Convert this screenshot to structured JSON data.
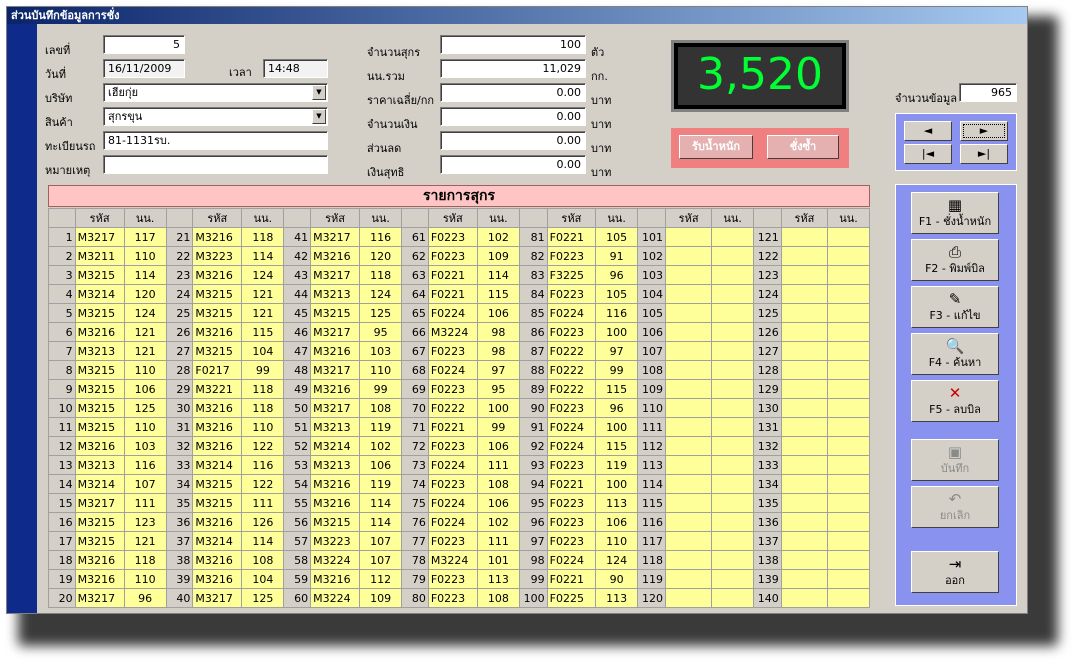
{
  "window": {
    "title": "ส่วนบันทึกข้อมูลการชั่ง"
  },
  "form": {
    "doc_no_label": "เลขที่",
    "doc_no": "5",
    "date_label": "วันที่",
    "date": "16/11/2009",
    "time_label": "เวลา",
    "time": "14:48",
    "company_label": "บริษัท",
    "company": "เฮียกุ่ย",
    "product_label": "สินค้า",
    "product": "สุกรขุน",
    "plate_label": "ทะเบียนรถ",
    "plate": "81-1131รบ.",
    "note_label": "หมายเหตุ",
    "note": "",
    "pig_count_label": "จำนวนสุกร",
    "pig_count": "100",
    "pig_count_unit": "ตัว",
    "total_weight_label": "นน.รวม",
    "total_weight": "11,029",
    "total_weight_unit": "กก.",
    "avg_price_label": "ราคาเฉลี่ย/กก",
    "avg_price": "0.00",
    "avg_price_unit": "บาท",
    "amount_label": "จำนวนเงิน",
    "amount": "0.00",
    "amount_unit": "บาท",
    "discount_label": "ส่วนลด",
    "discount": "0.00",
    "discount_unit": "บาท",
    "net_label": "เงินสุทธิ",
    "net": "0.00",
    "net_unit": "บาท"
  },
  "display": {
    "weight": "3,520",
    "color": "#00ff33"
  },
  "weigh_buttons": {
    "receive": "รับน้ำหนัก",
    "reweigh": "ชั่งซ้ำ"
  },
  "record_count": {
    "label": "จำนวนข้อมูล",
    "value": "965"
  },
  "nav": {
    "prev": "◄",
    "next": "►",
    "first": "|◄",
    "last": "►|"
  },
  "functions": [
    {
      "icon": "calculator-icon",
      "glyph": "▦",
      "label": "F1 - ชั่งน้ำหนัก",
      "enabled": true
    },
    {
      "icon": "printer-icon",
      "glyph": "⎙",
      "label": "F2 - พิมพ์บิล",
      "enabled": true
    },
    {
      "icon": "wrench-icon",
      "glyph": "✎",
      "label": "F3 - แก้ไข",
      "enabled": true
    },
    {
      "icon": "find-icon",
      "glyph": "🔍",
      "label": "F4 - ค้นหา",
      "enabled": true
    },
    {
      "icon": "delete-icon",
      "glyph": "✕",
      "label": "F5 - ลบบิล",
      "enabled": true
    },
    {
      "icon": "save-icon",
      "glyph": "▣",
      "label": "บันทึก",
      "enabled": false
    },
    {
      "icon": "undo-icon",
      "glyph": "↶",
      "label": "ยกเลิก",
      "enabled": false
    },
    {
      "icon": "exit-icon",
      "glyph": "⇥",
      "label": "ออก",
      "enabled": true
    }
  ],
  "table": {
    "title": "รายการสุกร",
    "col_code": "รหัส",
    "col_weight": "นน.",
    "columns": [
      {
        "codes": [
          "M3217",
          "M3211",
          "M3215",
          "M3214",
          "M3215",
          "M3216",
          "M3213",
          "M3215",
          "M3215",
          "M3215",
          "M3215",
          "M3216",
          "M3213",
          "M3214",
          "M3217",
          "M3215",
          "M3215",
          "M3216",
          "M3216",
          "M3217"
        ],
        "weights": [
          "117",
          "110",
          "114",
          "120",
          "124",
          "121",
          "121",
          "110",
          "106",
          "125",
          "110",
          "103",
          "116",
          "107",
          "111",
          "123",
          "121",
          "118",
          "110",
          "96"
        ]
      },
      {
        "codes": [
          "M3216",
          "M3223",
          "M3216",
          "M3215",
          "M3215",
          "M3216",
          "M3215",
          "F0217",
          "M3221",
          "M3216",
          "M3216",
          "M3216",
          "M3214",
          "M3215",
          "M3215",
          "M3216",
          "M3214",
          "M3216",
          "M3216",
          "M3217"
        ],
        "weights": [
          "118",
          "114",
          "124",
          "121",
          "121",
          "115",
          "104",
          "99",
          "118",
          "118",
          "110",
          "122",
          "116",
          "122",
          "111",
          "126",
          "114",
          "108",
          "104",
          "125"
        ]
      },
      {
        "codes": [
          "M3217",
          "M3216",
          "M3217",
          "M3213",
          "M3215",
          "M3217",
          "M3216",
          "M3217",
          "M3216",
          "M3217",
          "M3213",
          "M3214",
          "M3213",
          "M3216",
          "M3216",
          "M3215",
          "M3223",
          "M3224",
          "M3216",
          "M3224"
        ],
        "weights": [
          "116",
          "120",
          "118",
          "124",
          "125",
          "95",
          "103",
          "110",
          "99",
          "108",
          "119",
          "102",
          "106",
          "119",
          "114",
          "114",
          "107",
          "107",
          "112",
          "109"
        ]
      },
      {
        "codes": [
          "F0223",
          "F0223",
          "F0221",
          "F0221",
          "F0224",
          "M3224",
          "F0223",
          "F0224",
          "F0223",
          "F0222",
          "F0221",
          "F0223",
          "F0224",
          "F0223",
          "F0224",
          "F0224",
          "F0223",
          "M3224",
          "F0223",
          "F0223"
        ],
        "weights": [
          "102",
          "109",
          "114",
          "115",
          "106",
          "98",
          "98",
          "97",
          "95",
          "100",
          "99",
          "106",
          "111",
          "108",
          "106",
          "102",
          "111",
          "101",
          "113",
          "108"
        ]
      },
      {
        "codes": [
          "F0221",
          "F0223",
          "F3225",
          "F0223",
          "F0224",
          "F0223",
          "F0222",
          "F0222",
          "F0222",
          "F0223",
          "F0224",
          "F0224",
          "F0223",
          "F0221",
          "F0223",
          "F0223",
          "F0223",
          "F0224",
          "F0221",
          "F0225"
        ],
        "weights": [
          "105",
          "91",
          "96",
          "105",
          "116",
          "100",
          "97",
          "99",
          "115",
          "96",
          "100",
          "115",
          "119",
          "100",
          "113",
          "106",
          "110",
          "124",
          "90",
          "113"
        ]
      },
      {
        "codes": [
          "",
          "",
          "",
          "",
          "",
          "",
          "",
          "",
          "",
          "",
          "",
          "",
          "",
          "",
          "",
          "",
          "",
          "",
          "",
          ""
        ],
        "weights": [
          "",
          "",
          "",
          "",
          "",
          "",
          "",
          "",
          "",
          "",
          "",
          "",
          "",
          "",
          "",
          "",
          "",
          "",
          "",
          ""
        ]
      },
      {
        "codes": [
          "",
          "",
          "",
          "",
          "",
          "",
          "",
          "",
          "",
          "",
          "",
          "",
          "",
          "",
          "",
          "",
          "",
          "",
          "",
          ""
        ],
        "weights": [
          "",
          "",
          "",
          "",
          "",
          "",
          "",
          "",
          "",
          "",
          "",
          "",
          "",
          "",
          "",
          "",
          "",
          "",
          "",
          ""
        ]
      }
    ]
  }
}
